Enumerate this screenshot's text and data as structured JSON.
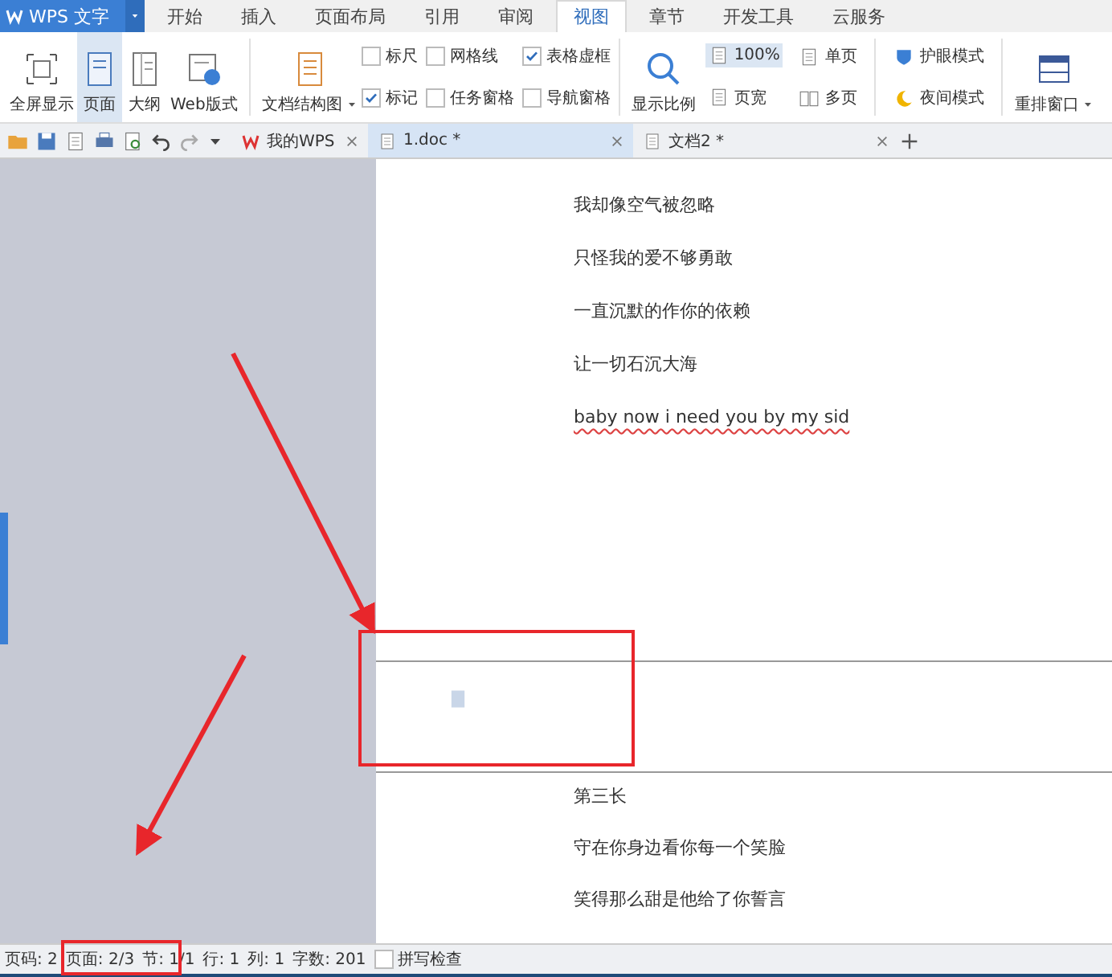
{
  "app": {
    "name": "WPS 文字"
  },
  "menu_tabs": [
    {
      "label": "开始",
      "selected": false
    },
    {
      "label": "插入",
      "selected": false
    },
    {
      "label": "页面布局",
      "selected": false
    },
    {
      "label": "引用",
      "selected": false
    },
    {
      "label": "审阅",
      "selected": false
    },
    {
      "label": "视图",
      "selected": true
    },
    {
      "label": "章节",
      "selected": false
    },
    {
      "label": "开发工具",
      "selected": false
    },
    {
      "label": "云服务",
      "selected": false
    }
  ],
  "view_modes": [
    {
      "label": "全屏显示",
      "selected": false
    },
    {
      "label": "页面",
      "selected": true
    },
    {
      "label": "大纲",
      "selected": false
    },
    {
      "label": "Web版式",
      "selected": false
    }
  ],
  "doc_map": {
    "label": "文档结构图"
  },
  "show_options": [
    {
      "label": "标尺",
      "checked": false
    },
    {
      "label": "网格线",
      "checked": false
    },
    {
      "label": "表格虚框",
      "checked": true
    },
    {
      "label": "标记",
      "checked": true
    },
    {
      "label": "任务窗格",
      "checked": false
    },
    {
      "label": "导航窗格",
      "checked": false
    }
  ],
  "zoom": {
    "label": "显示比例",
    "value": "100%",
    "fit_width": "页宽",
    "single_page": "单页",
    "multi_page": "多页"
  },
  "modes": {
    "eye_care": "护眼模式",
    "night": "夜间模式"
  },
  "arrange": {
    "label": "重排窗口"
  },
  "doc_tabs": [
    {
      "label": "我的WPS",
      "kind": "home",
      "selected": false
    },
    {
      "label": "1.doc *",
      "kind": "doc",
      "selected": true
    },
    {
      "label": "文档2 *",
      "kind": "doc",
      "selected": false
    }
  ],
  "page1_lines": [
    {
      "text": "我却像空气被忽略",
      "spell_error": false
    },
    {
      "text": "只怪我的爱不够勇敢",
      "spell_error": false
    },
    {
      "text": "一直沉默的作你的依赖",
      "spell_error": false
    },
    {
      "text": "让一切石沉大海",
      "spell_error": false
    },
    {
      "text": "baby now i need you by my sid",
      "spell_error": true
    }
  ],
  "page2_lines": [
    {
      "text": "第三长",
      "spell_error": false
    },
    {
      "text": "守在你身边看你每一个笑脸",
      "spell_error": false
    },
    {
      "text": "笑得那么甜是他给了你誓言",
      "spell_error": false
    }
  ],
  "status_bar": {
    "items": [
      "页码: 2",
      "页面: 2/3",
      "节: 1/1",
      "行: 1",
      "列: 1",
      "字数: 201"
    ],
    "spell_check": {
      "label": "拼写检查",
      "checked": false
    }
  }
}
